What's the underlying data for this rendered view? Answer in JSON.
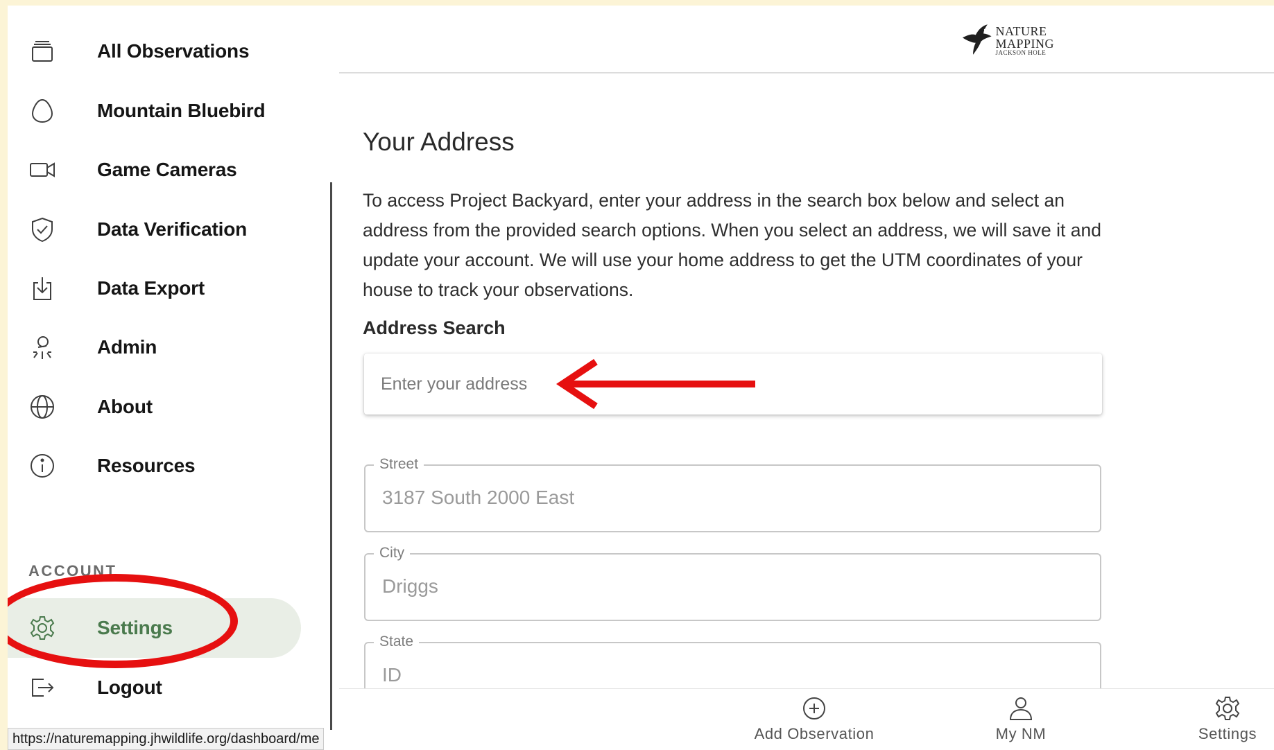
{
  "sidebar": {
    "items": [
      {
        "label": "All Observations",
        "icon": "stack-icon"
      },
      {
        "label": "Mountain Bluebird",
        "icon": "egg-icon"
      },
      {
        "label": "Game Cameras",
        "icon": "video-camera-icon"
      },
      {
        "label": "Data Verification",
        "icon": "shield-check-icon"
      },
      {
        "label": "Data Export",
        "icon": "download-icon"
      },
      {
        "label": "Admin",
        "icon": "admin-user-icon"
      },
      {
        "label": "About",
        "icon": "globe-icon"
      },
      {
        "label": "Resources",
        "icon": "info-icon"
      }
    ],
    "account_label": "ACCOUNT",
    "account_items": [
      {
        "label": "Settings",
        "icon": "gear-icon",
        "active": true
      },
      {
        "label": "Logout",
        "icon": "logout-icon"
      }
    ]
  },
  "status_bar": {
    "url": "https://naturemapping.jhwildlife.org/dashboard/me"
  },
  "header": {
    "logo": {
      "line1": "NATURE",
      "line2": "MAPPING",
      "line3": "JACKSON HOLE"
    }
  },
  "main": {
    "title": "Your Address",
    "intro": "To access Project Backyard, enter your address in the search box below and select an address from the provided search options. When you select an address, we will save it and update your account. We will use your home address to get the UTM coordinates of your house to track your observations.",
    "search": {
      "heading": "Address Search",
      "placeholder": "Enter your address",
      "value": ""
    },
    "fields": [
      {
        "label": "Street",
        "value": "3187 South 2000 East"
      },
      {
        "label": "City",
        "value": "Driggs"
      },
      {
        "label": "State",
        "value": "ID"
      }
    ]
  },
  "bottom_nav": {
    "items": [
      {
        "label": "Add Observation",
        "icon": "plus-circle-icon"
      },
      {
        "label": "My NM",
        "icon": "person-icon"
      },
      {
        "label": "Settings",
        "icon": "gear-icon"
      }
    ]
  },
  "colors": {
    "page_background": "#fcf4d6",
    "active_item_background": "#e9eee6",
    "active_item_text": "#4a7a4d",
    "annotation_red": "#e61010"
  }
}
